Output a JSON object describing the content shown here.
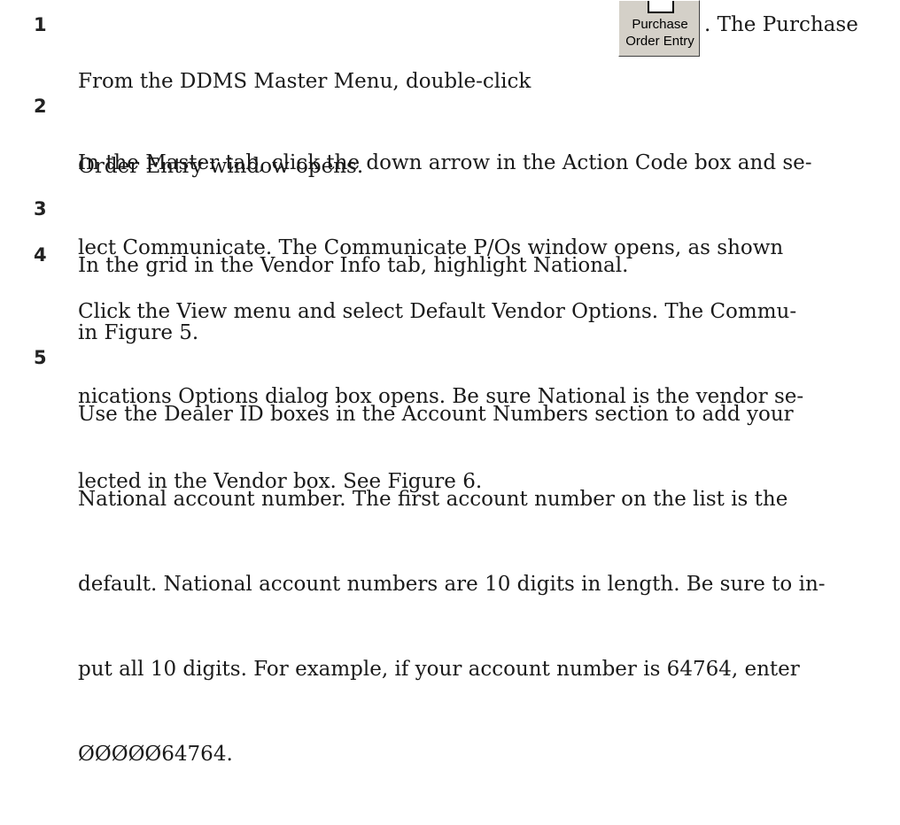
{
  "steps": [
    {
      "number": "1",
      "lines": [
        "From the DDMS Master Menu, double-click",
        "Order Entry window opens."
      ],
      "after_icon": ". The Purchase",
      "icon": {
        "name": "purchase-order-entry-icon",
        "label_line1": "Purchase",
        "label_line2": "Order Entry"
      }
    },
    {
      "number": "2",
      "lines": [
        "In the Master tab, click the down arrow in the Action Code box and se-",
        "lect Communicate. The Communicate P/Os window opens, as shown",
        "in Figure 5."
      ]
    },
    {
      "number": "3",
      "lines": [
        "In the grid in the Vendor Info tab, highlight National."
      ]
    },
    {
      "number": "4",
      "lines": [
        "Click the View menu and select Default Vendor Options. The Commu-",
        "nications Options dialog box opens. Be sure National is the vendor se-",
        "lected in the Vendor box. See Figure 6."
      ]
    },
    {
      "number": "5",
      "lines": [
        "Use the Dealer ID boxes in the Account Numbers section to add your",
        "National account number. The first account number on the list is the",
        "default. National account numbers are 10 digits in length. Be sure to in-",
        "put all 10 digits. For example, if your account number is 64764, enter",
        "ØØØØØ64764."
      ]
    }
  ]
}
